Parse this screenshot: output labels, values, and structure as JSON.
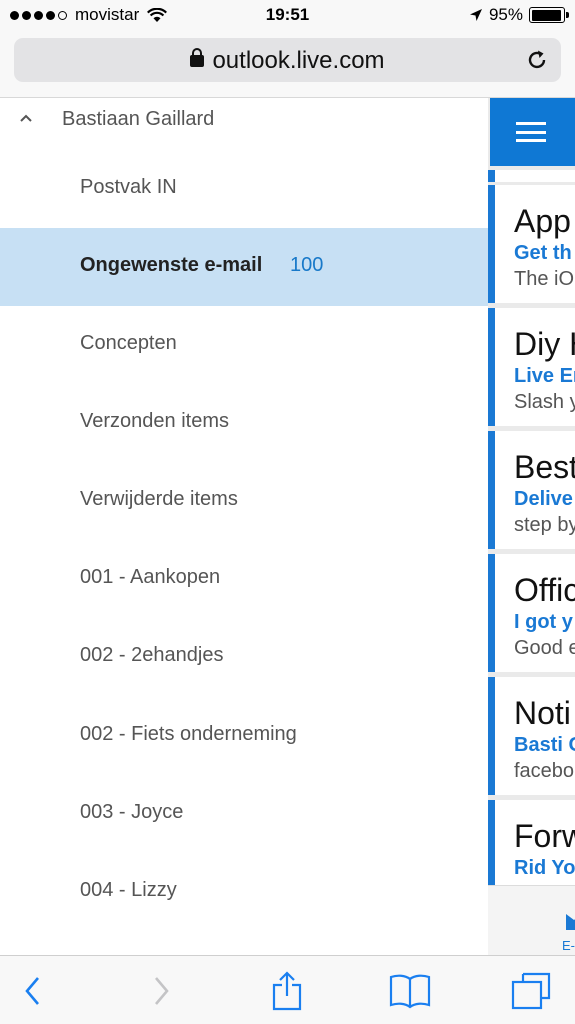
{
  "status_bar": {
    "carrier": "movistar",
    "time": "19:51",
    "battery": "95%",
    "battery_level": 0.95
  },
  "browser": {
    "url": "outlook.live.com"
  },
  "folder_pane": {
    "account": "Bastiaan Gaillard",
    "folders": [
      {
        "label": "Postvak IN",
        "count": ""
      },
      {
        "label": "Ongewenste e-mail",
        "count": "100",
        "selected": true
      },
      {
        "label": "Concepten",
        "count": ""
      },
      {
        "label": "Verzonden items",
        "count": ""
      },
      {
        "label": "Verwijderde items",
        "count": ""
      },
      {
        "label": "001 - Aankopen",
        "count": ""
      },
      {
        "label": "002 - 2ehandjes",
        "count": ""
      },
      {
        "label": "002 - Fiets onderneming",
        "count": ""
      },
      {
        "label": "003 - Joyce",
        "count": ""
      },
      {
        "label": "004 - Lizzy",
        "count": ""
      }
    ]
  },
  "message_list": {
    "messages": [
      {
        "sender": "App",
        "subject": "Get th",
        "preview": "The iO"
      },
      {
        "sender": "Diy H",
        "subject": "Live Er",
        "preview": "Slash y"
      },
      {
        "sender": "Best",
        "subject": "Delive",
        "preview": "step by"
      },
      {
        "sender": "Offic",
        "subject": "I got y",
        "preview": "Good e"
      },
      {
        "sender": "Noti",
        "subject": "Basti G",
        "preview": "facebo"
      },
      {
        "sender": "Forw",
        "subject": "Rid Yo",
        "preview": ""
      }
    ],
    "bottom_tab_label": "E-"
  },
  "colors": {
    "accent": "#0f78d4",
    "selected_bg": "#c7e0f4",
    "count": "#1879c9",
    "ios_blue": "#1a7ff0"
  },
  "icons": {
    "back": "chevron-left-icon",
    "forward": "chevron-right-icon",
    "share": "share-icon",
    "bookmarks": "book-icon",
    "tabs": "tabs-icon"
  }
}
